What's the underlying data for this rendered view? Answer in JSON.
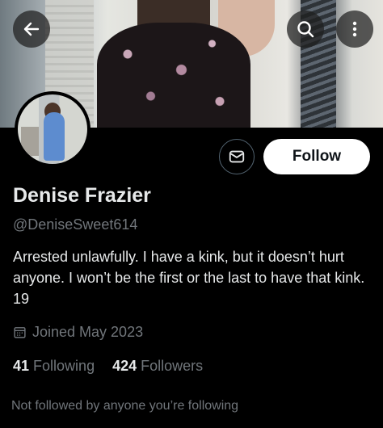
{
  "header": {
    "back_icon": "arrow-left-icon",
    "search_icon": "search-icon",
    "more_icon": "vertical-dots-icon"
  },
  "profile": {
    "name": "Denise Frazier",
    "handle": "@DeniseSweet614",
    "bio": "Arrested unlawfully.  I have a kink, but it doesn’t hurt anyone. I won’t be the first or the last to have that kink. 19",
    "joined": "Joined May 2023",
    "following_count": "41",
    "following_label": "Following",
    "followers_count": "424",
    "followers_label": "Followers",
    "mutual_text": "Not followed by anyone you’re following"
  },
  "actions": {
    "follow_label": "Follow",
    "message_icon": "envelope-icon"
  },
  "colors": {
    "background": "#000000",
    "primary_text": "#e7e9ea",
    "secondary_text": "#71767b",
    "follow_button_bg": "#ffffff"
  }
}
